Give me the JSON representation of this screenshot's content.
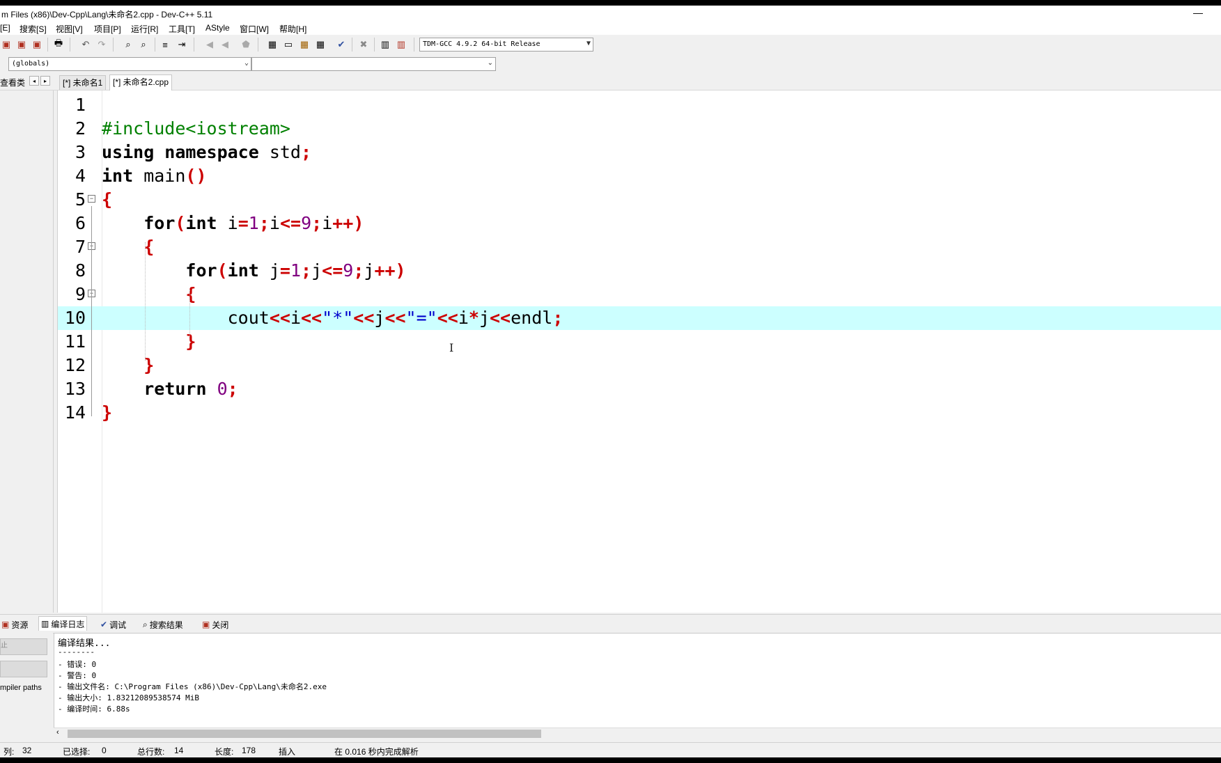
{
  "window": {
    "title": "m Files (x86)\\Dev-Cpp\\Lang\\未命名2.cpp - Dev-C++ 5.11",
    "minimize_glyph": "—"
  },
  "menu": [
    "[E]",
    "搜索[S]",
    "视图[V]",
    "项目[P]",
    "运行[R]",
    "工具[T]",
    "AStyle",
    "窗口[W]",
    "帮助[H]"
  ],
  "toolbar": {
    "compiler": "TDM-GCC 4.9.2 64-bit Release"
  },
  "combos": {
    "scope": "(globals)",
    "member": ""
  },
  "tabs": {
    "left_label": "查看类",
    "prev": "◂",
    "next": "▸",
    "files": [
      "[*] 未命名1",
      "[*] 未命名2.cpp"
    ]
  },
  "editor": {
    "line_numbers": [
      "1",
      "2",
      "3",
      "4",
      "5",
      "6",
      "7",
      "8",
      "9",
      "10",
      "11",
      "12",
      "13",
      "14"
    ],
    "current_line": 10
  },
  "bottom_tabs": [
    "资源",
    "编译日志",
    "调试",
    "搜索结果",
    "关闭"
  ],
  "bottom_left": {
    "button1": "止",
    "button2": "",
    "paths": "mpiler paths"
  },
  "log": {
    "title": "编译结果...",
    "divider": "--------",
    "errors": "- 错误: 0",
    "warnings": "- 警告: 0",
    "output_file": "- 输出文件名: C:\\Program Files (x86)\\Dev-Cpp\\Lang\\未命名2.exe",
    "output_size": "- 输出大小: 1.83212089538574 MiB",
    "compile_time": "- 编译时间: 6.88s"
  },
  "status": {
    "col_label": "列:",
    "col_value": "32",
    "sel_label": "已选择:",
    "sel_value": "0",
    "lines_label": "总行数:",
    "lines_value": "14",
    "len_label": "长度:",
    "len_value": "178",
    "mode": "插入",
    "parse": "在 0.016 秒内完成解析"
  }
}
